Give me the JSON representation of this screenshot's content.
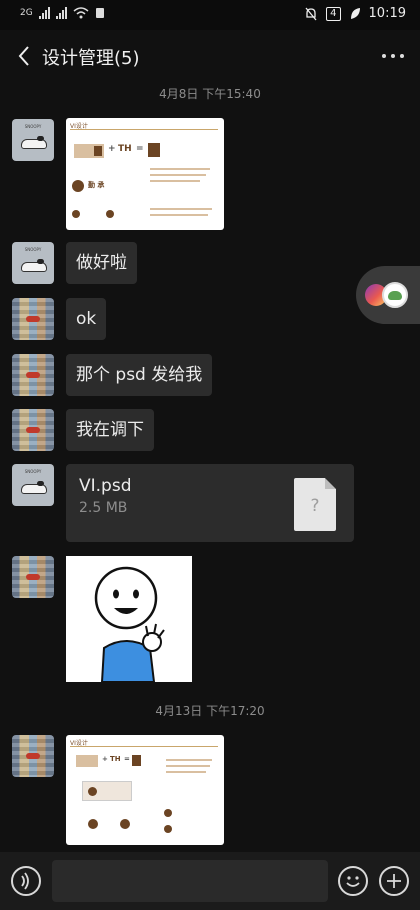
{
  "status_bar": {
    "network_left": "2G",
    "battery": "4",
    "clock": "10:19"
  },
  "header": {
    "title": "设计管理(5)"
  },
  "timestamps": [
    "4月8日 下午15:40",
    "4月13日 下午17:20"
  ],
  "messages": [
    {
      "type": "image",
      "sender": "snoopy",
      "image": "VI设计"
    },
    {
      "type": "text",
      "sender": "snoopy",
      "text": "做好啦"
    },
    {
      "type": "text",
      "sender": "street",
      "text": "ok"
    },
    {
      "type": "text",
      "sender": "street",
      "text": "那个 psd 发给我"
    },
    {
      "type": "text",
      "sender": "street",
      "text": "我在调下"
    },
    {
      "type": "file",
      "sender": "snoopy",
      "file_name": "VI.psd",
      "file_size": "2.5 MB",
      "file_icon": "?"
    },
    {
      "type": "sticker",
      "sender": "street",
      "sticker": "smiling-cartoon-ok-hand"
    },
    {
      "type": "image",
      "sender": "street",
      "image": "VI设计"
    }
  ],
  "vi_image": {
    "heading": "VI设计",
    "formula_plus": "+",
    "formula_th": "TH",
    "formula_eq": "=",
    "logo_char": "勤",
    "logo_text": "勤 承",
    "avatar_label": "SNOOPY"
  },
  "composer": {
    "input_value": ""
  },
  "icons": {
    "back": "back-arrow-icon",
    "more": "more-dots-icon",
    "voice": "voice-icon",
    "emoji": "emoji-icon",
    "add": "plus-icon"
  }
}
